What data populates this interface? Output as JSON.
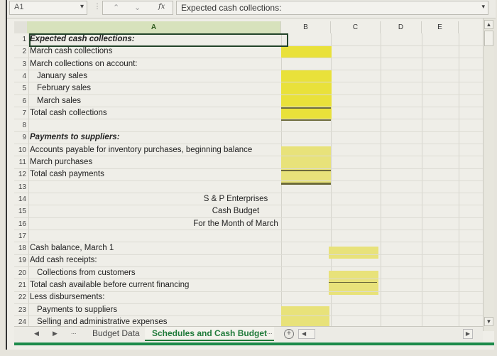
{
  "formula_bar": {
    "name_box": "A1",
    "fx_label": "fx",
    "formula": "Expected cash collections:"
  },
  "columns": [
    "A",
    "B",
    "C",
    "D",
    "E"
  ],
  "rows": [
    {
      "num": "1",
      "text": "Expected cash collections:",
      "style": "bi"
    },
    {
      "num": "2",
      "text": "March cash collections"
    },
    {
      "num": "3",
      "text": "March collections on account:"
    },
    {
      "num": "4",
      "text": "January sales",
      "style": "ind"
    },
    {
      "num": "5",
      "text": "February sales",
      "style": "ind"
    },
    {
      "num": "6",
      "text": "March sales",
      "style": "ind"
    },
    {
      "num": "7",
      "text": "Total cash collections"
    },
    {
      "num": "8",
      "text": ""
    },
    {
      "num": "9",
      "text": "Payments to suppliers:",
      "style": "bi"
    },
    {
      "num": "10",
      "text": "Accounts payable for inventory purchases, beginning balance"
    },
    {
      "num": "11",
      "text": "March purchases"
    },
    {
      "num": "12",
      "text": "Total cash payments"
    },
    {
      "num": "13",
      "text": ""
    },
    {
      "num": "14",
      "text": "S & P Enterprises",
      "style": "center"
    },
    {
      "num": "15",
      "text": "Cash Budget",
      "style": "center"
    },
    {
      "num": "16",
      "text": "For the Month of March",
      "style": "center"
    },
    {
      "num": "17",
      "text": ""
    },
    {
      "num": "18",
      "text": "Cash balance, March 1"
    },
    {
      "num": "19",
      "text": "Add cash receipts:"
    },
    {
      "num": "20",
      "text": "Collections from customers",
      "style": "ind"
    },
    {
      "num": "21",
      "text": "Total cash available before current financing"
    },
    {
      "num": "22",
      "text": "Less disbursements:"
    },
    {
      "num": "23",
      "text": "Payments to suppliers",
      "style": "ind"
    },
    {
      "num": "24",
      "text": "Selling and administrative expenses",
      "style": "ind"
    }
  ],
  "sheet_tabs": {
    "nav_prev": "◀",
    "nav_next": "▶",
    "more_left": "...",
    "tabs": [
      {
        "label": "Budget Data",
        "active": false
      },
      {
        "label": "Schedules and Cash Budget",
        "active": true
      }
    ],
    "more_right": "...",
    "add_sheet": "+"
  },
  "colors": {
    "input_cell": "#e9e13a",
    "active_tab": "#1f7a3a",
    "selected_header": "#d7e2bc"
  }
}
